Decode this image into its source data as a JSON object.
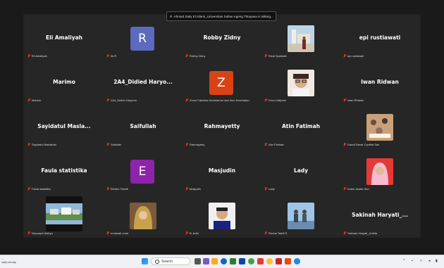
{
  "talking_banner": "R. Ahmad Zaky El Islami_Universitas Sultan Ageng Tirtayasa is talking...",
  "tiles": [
    {
      "display": "Eli Amaliyah",
      "label": "Eli Amaliyah"
    },
    {
      "avatar": "R",
      "avatar_color": "#5c6bc0",
      "label": "Ifa R"
    },
    {
      "display": "Robby Zidny",
      "label": "Robby Zidny"
    },
    {
      "photo": "monument",
      "label": "Rizal Syaifudin"
    },
    {
      "display": "epi rustiawati",
      "label": "epi rustiawati"
    },
    {
      "display": "Marimo",
      "label": "Marimo"
    },
    {
      "display": "2A4_Didied Haryo...",
      "label": "2A4_Didied Haryono"
    },
    {
      "avatar": "Z",
      "avatar_color": "#d84315",
      "label": "Zoom Fakultas Kedokteran dan Ilmu Kesehatan"
    },
    {
      "photo": "woman-glasses",
      "label": "Erny Listijorini"
    },
    {
      "display": "Iwan Ridwan",
      "label": "Iwan Ridwan"
    },
    {
      "display": "Sayidatul Masla...",
      "label": "Sayidatul Maslahah"
    },
    {
      "display": "Saifullah",
      "label": "Saifullah"
    },
    {
      "display": "Rahmayetty",
      "label": "Rahmayetty"
    },
    {
      "display": "Atin Fatimah",
      "label": "Atin Fatimah"
    },
    {
      "photo": "group",
      "label": "Dandi Danar Cynthia Sari"
    },
    {
      "display": "Faula statistika",
      "label": "Faula statistika"
    },
    {
      "avatar": "E",
      "avatar_color": "#8e24aa",
      "label": "Elektro Teknik"
    },
    {
      "display": "Masjudin",
      "label": "Masjudin"
    },
    {
      "display": "Lady",
      "label": "Lady"
    },
    {
      "photo": "hijab-red",
      "label": "Indah Jawita Sari"
    },
    {
      "photo": "campus",
      "label": "Nurprapti Wahyu"
    },
    {
      "photo": "woman-hijab",
      "label": "ernawati umar"
    },
    {
      "photo": "man",
      "label": "B. Adhi"
    },
    {
      "photo": "group-stand",
      "label": "Renda Taedi R"
    },
    {
      "display": "Sakinah Haryati_...",
      "label": "Sakinah Haryati_Untirta"
    }
  ],
  "taskbar": {
    "weather_line1": "...",
    "weather_line2": "ostly cloudy",
    "search_placeholder": "Search"
  }
}
